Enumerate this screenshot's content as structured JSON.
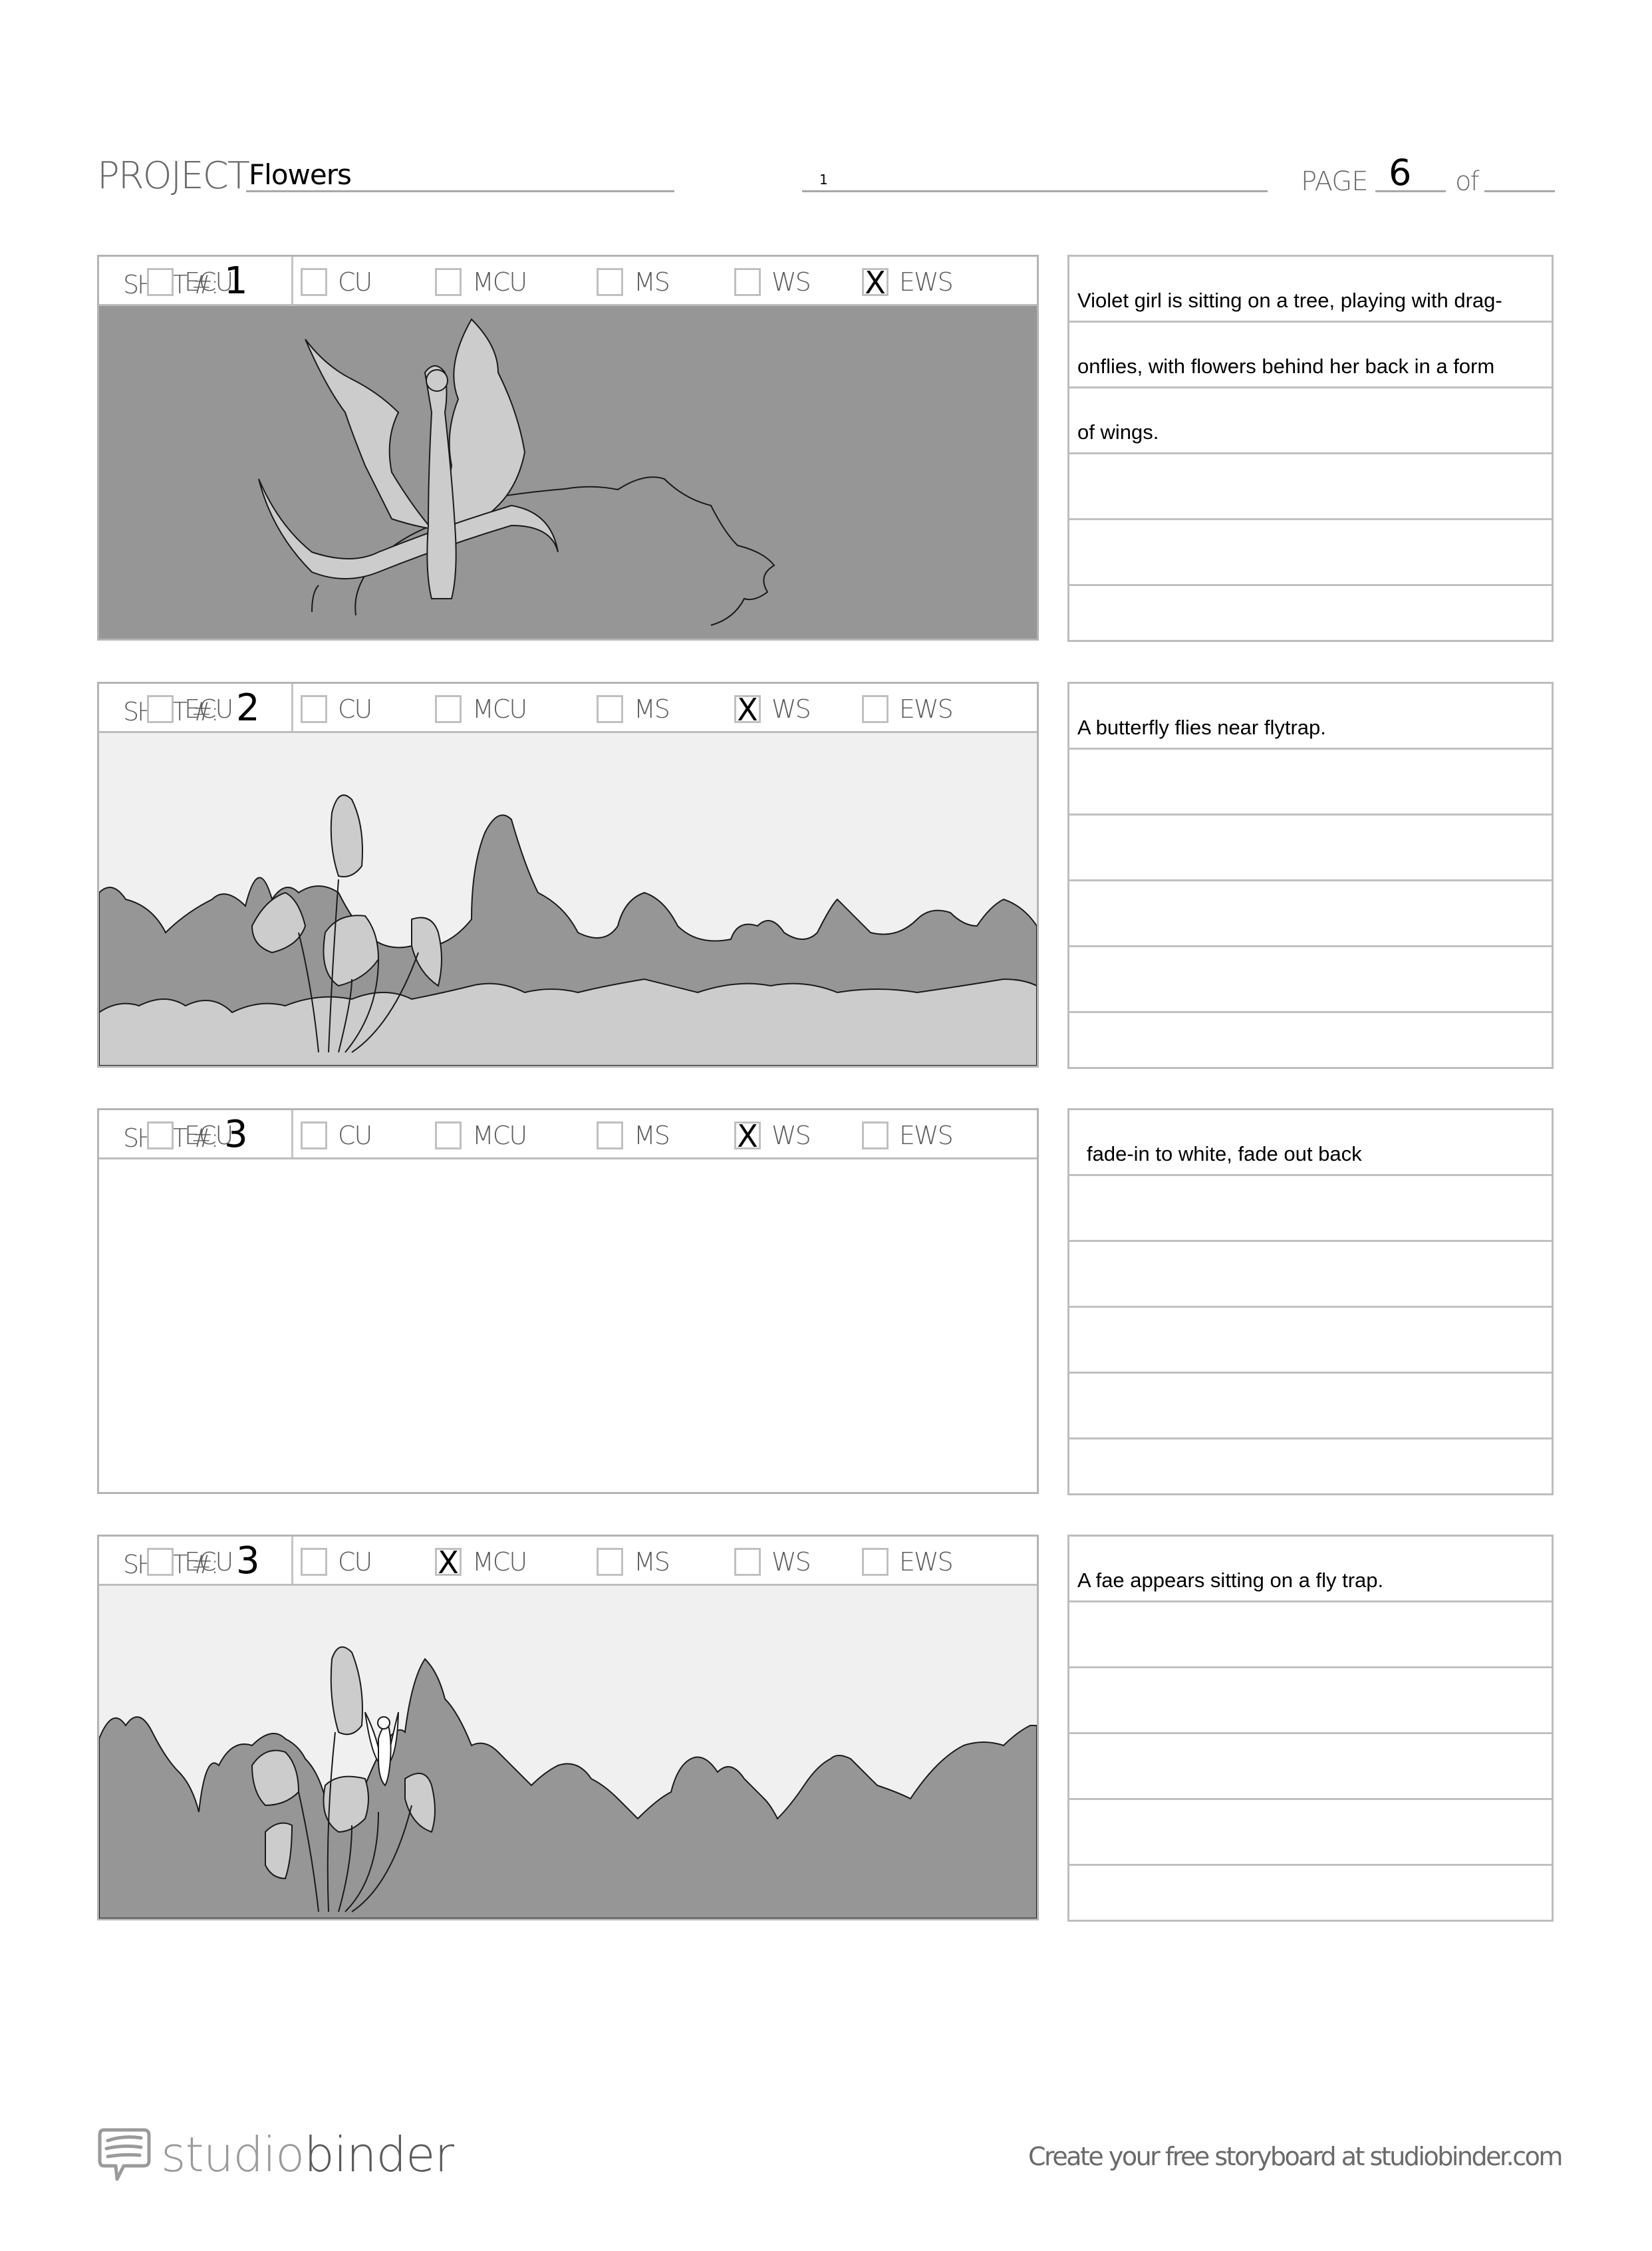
{
  "header": {
    "project_label": "PROJECT",
    "project_value": "Flowers",
    "episode_value": "1",
    "page_label": "PAGE",
    "page_value": "6",
    "of_label": "of",
    "of_value": ""
  },
  "shot_type_options": [
    "ECU",
    "CU",
    "MCU",
    "MS",
    "WS",
    "EWS"
  ],
  "shots": [
    {
      "label": "SHOT #:",
      "number": "1",
      "selected_type": "EWS",
      "mark": "X",
      "frame": "fairy-on-branch",
      "description_lines": [
        "Violet girl is sitting on a tree, playing with drag-",
        "onflies, with flowers behind her back in a form",
        "of wings.",
        "",
        "",
        ""
      ]
    },
    {
      "label": "SHOT #:",
      "number": "2",
      "selected_type": "WS",
      "mark": "X",
      "frame": "flytrap-bushes",
      "description_lines": [
        "A butterfly flies near flytrap.",
        "",
        "",
        "",
        "",
        ""
      ]
    },
    {
      "label": "SHOT #:",
      "number": "3",
      "selected_type": "WS",
      "mark": "X",
      "frame": "blank",
      "description_lines": [
        "fade-in to white, fade out back",
        "",
        "",
        "",
        "",
        ""
      ]
    },
    {
      "label": "SHOT #:",
      "number": "3",
      "selected_type": "MCU",
      "mark": "X",
      "frame": "fae-on-flytrap",
      "description_lines": [
        "A fae appears sitting on a fly trap.",
        "",
        "",
        "",
        "",
        ""
      ]
    }
  ],
  "footer": {
    "logo_part1": "studio",
    "logo_part2": "binder",
    "logo_icon": "speech-bubble-icon",
    "cta": "Create your free storyboard at studiobinder.com"
  },
  "colors": {
    "art_dark": "#979697",
    "art_mid": "#cdcccd",
    "art_light": "#f0f0f0",
    "line": "#1a1a1a",
    "rule": "#bdbdbd",
    "label_gray": "#5c5c5c"
  }
}
